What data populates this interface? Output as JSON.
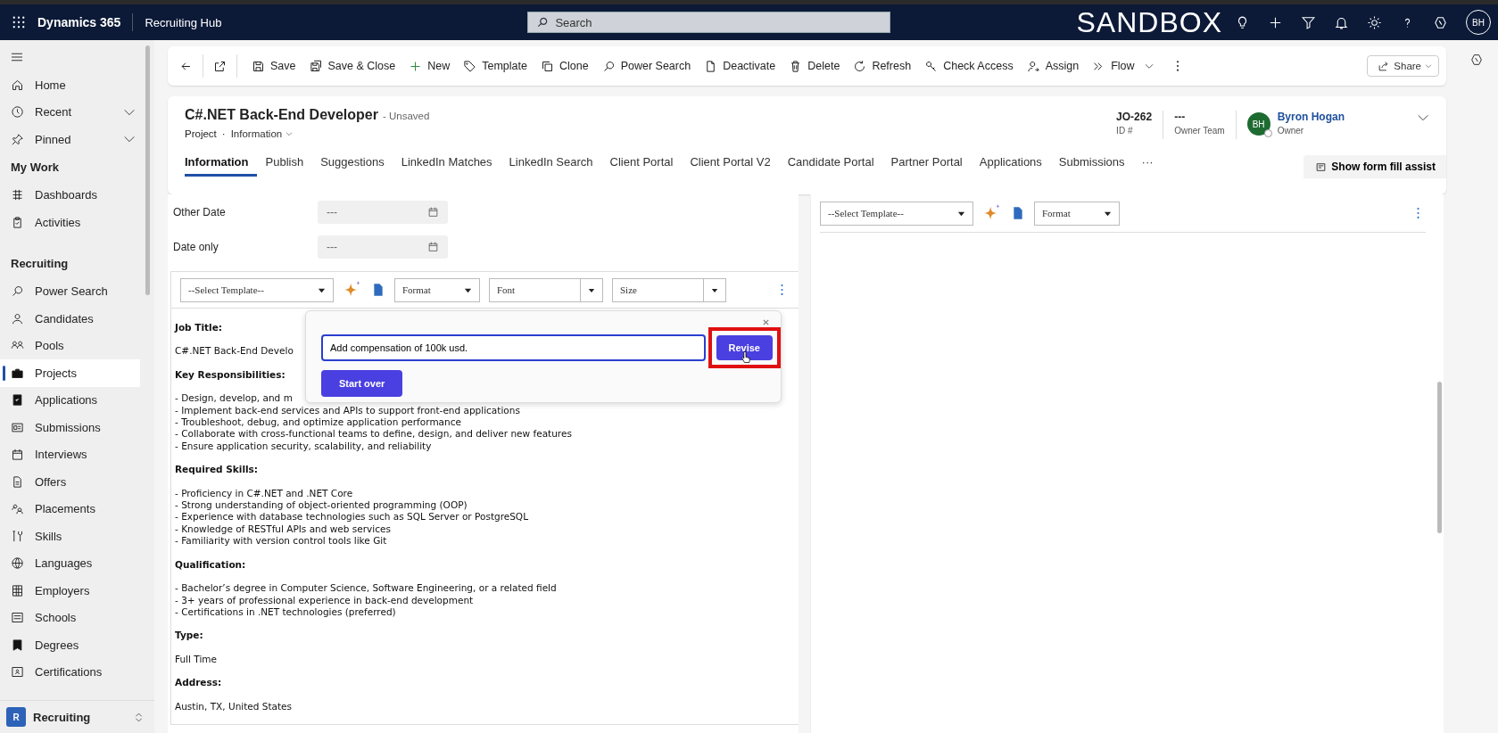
{
  "top_bar": {
    "app_name": "Dynamics 365",
    "area": "Recruiting Hub",
    "search": {
      "placeholder": "Search"
    },
    "environment": "SANDBOX",
    "avatar": "BH"
  },
  "command_bar": {
    "items": [
      {
        "label": "Save",
        "dropdown": false
      },
      {
        "label": "Save & Close",
        "dropdown": false
      },
      {
        "label": "New",
        "dropdown": false
      },
      {
        "label": "Template",
        "dropdown": false
      },
      {
        "label": "Clone",
        "dropdown": false
      },
      {
        "label": "Power Search",
        "dropdown": false
      },
      {
        "label": "Deactivate",
        "dropdown": false
      },
      {
        "label": "Delete",
        "dropdown": false
      },
      {
        "label": "Refresh",
        "dropdown": false
      },
      {
        "label": "Check Access",
        "dropdown": false
      },
      {
        "label": "Assign",
        "dropdown": false
      },
      {
        "label": "Flow",
        "dropdown": true
      }
    ],
    "share": "Share"
  },
  "sidebar": {
    "sections": [
      {
        "items": [
          {
            "label": "Home",
            "expandable": false,
            "selected": false
          },
          {
            "label": "Recent",
            "expandable": true,
            "selected": false
          },
          {
            "label": "Pinned",
            "expandable": true,
            "selected": false
          }
        ]
      },
      {
        "title": "My Work",
        "items": [
          {
            "label": "Dashboards",
            "expandable": false,
            "selected": false
          },
          {
            "label": "Activities",
            "expandable": false,
            "selected": false
          }
        ]
      },
      {
        "title": "Recruiting",
        "items": [
          {
            "label": "Power Search",
            "expandable": false,
            "selected": false
          },
          {
            "label": "Candidates",
            "expandable": false,
            "selected": false
          },
          {
            "label": "Pools",
            "expandable": false,
            "selected": false
          },
          {
            "label": "Projects",
            "expandable": false,
            "selected": true
          },
          {
            "label": "Applications",
            "expandable": false,
            "selected": false
          },
          {
            "label": "Submissions",
            "expandable": false,
            "selected": false
          },
          {
            "label": "Interviews",
            "expandable": false,
            "selected": false
          },
          {
            "label": "Offers",
            "expandable": false,
            "selected": false
          },
          {
            "label": "Placements",
            "expandable": false,
            "selected": false
          },
          {
            "label": "Skills",
            "expandable": false,
            "selected": false
          },
          {
            "label": "Languages",
            "expandable": false,
            "selected": false
          },
          {
            "label": "Employers",
            "expandable": false,
            "selected": false
          },
          {
            "label": "Schools",
            "expandable": false,
            "selected": false
          },
          {
            "label": "Degrees",
            "expandable": false,
            "selected": false
          },
          {
            "label": "Certifications",
            "expandable": false,
            "selected": false
          }
        ]
      }
    ],
    "area_switcher": {
      "badge": "R",
      "label": "Recruiting"
    }
  },
  "header": {
    "title": "C#.NET Back-End Developer",
    "status": "- Unsaved",
    "entity": "Project",
    "separator": "·",
    "form": "Information",
    "fields": [
      {
        "value": "JO-262",
        "label": "ID #"
      },
      {
        "value": "---",
        "label": "Owner Team"
      }
    ],
    "owner": {
      "initials": "BH",
      "name": "Byron Hogan",
      "role": "Owner"
    },
    "tabs": [
      {
        "label": "Information",
        "selected": true
      },
      {
        "label": "Publish",
        "selected": false
      },
      {
        "label": "Suggestions",
        "selected": false
      },
      {
        "label": "LinkedIn Matches",
        "selected": false
      },
      {
        "label": "LinkedIn Search",
        "selected": false
      },
      {
        "label": "Client Portal",
        "selected": false
      },
      {
        "label": "Client Portal V2",
        "selected": false
      },
      {
        "label": "Candidate Portal",
        "selected": false
      },
      {
        "label": "Partner Portal",
        "selected": false
      },
      {
        "label": "Applications",
        "selected": false
      },
      {
        "label": "Submissions",
        "selected": false
      }
    ],
    "more": "···",
    "form_fill_assist": "Show form fill assist"
  },
  "form_fields": [
    {
      "label": "Other Date",
      "value": "---"
    },
    {
      "label": "Date only",
      "value": "---"
    }
  ],
  "left_editor": {
    "toolbar": {
      "template": "--Select Template--",
      "format": "Format",
      "font": "Font",
      "size": "Size"
    },
    "content": [
      {
        "kind": "heading",
        "text": "Job Title:"
      },
      {
        "kind": "paragraph",
        "lines": [
          "C#.NET Back-End Develo"
        ]
      },
      {
        "kind": "heading",
        "text": "Key Responsibilities:"
      },
      {
        "kind": "paragraph",
        "lines": [
          "- Design, develop, and m",
          "- Implement back-end services and APIs to support front-end applications",
          "- Troubleshoot, debug, and optimize application performance",
          "- Collaborate with cross-functional teams to define, design, and deliver new features",
          "- Ensure application security, scalability, and reliability"
        ]
      },
      {
        "kind": "heading",
        "text": "Required Skills:"
      },
      {
        "kind": "paragraph",
        "lines": [
          "- Proficiency in C#.NET and .NET Core",
          "- Strong understanding of object-oriented programming (OOP)",
          "- Experience with database technologies such as SQL Server or PostgreSQL",
          "- Knowledge of RESTful APIs and web services",
          "- Familiarity with version control tools like Git"
        ]
      },
      {
        "kind": "heading",
        "text": "Qualification:"
      },
      {
        "kind": "paragraph",
        "lines": [
          "- Bachelor’s degree in Computer Science, Software Engineering, or a related field",
          "- 3+ years of professional experience in back-end development",
          "- Certifications in .NET technologies (preferred)"
        ]
      },
      {
        "kind": "heading",
        "text": "Type:"
      },
      {
        "kind": "paragraph",
        "lines": [
          "Full Time"
        ]
      },
      {
        "kind": "heading",
        "text": "Address:"
      },
      {
        "kind": "paragraph",
        "lines": [
          "Austin, TX, United States"
        ]
      }
    ],
    "ai_popup": {
      "input": "Add compensation of 100k usd.",
      "revise": {
        "label": "Revise",
        "highlighted": true
      },
      "start_over": "Start over"
    }
  },
  "right_editor": {
    "toolbar": {
      "template": "--Select Template--",
      "format": "Format"
    }
  }
}
